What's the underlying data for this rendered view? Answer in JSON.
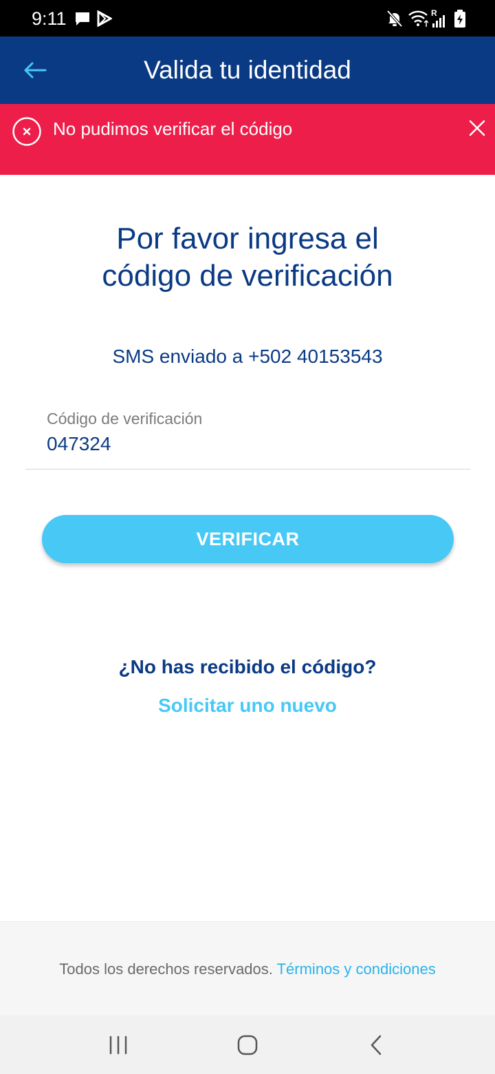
{
  "status_bar": {
    "time": "9:11",
    "left_icons": [
      "message-icon",
      "play-store-icon"
    ],
    "right_icons": [
      "mute-icon",
      "wifi-icon",
      "signal-icon",
      "battery-icon"
    ],
    "roaming_indicator": "R"
  },
  "app_bar": {
    "title": "Valida tu identidad",
    "back_icon": "arrow-left-icon"
  },
  "error_banner": {
    "message": "No pudimos verificar el código",
    "icon": "error-circle-x-icon",
    "close_icon": "close-icon"
  },
  "main": {
    "heading_line1": "Por favor ingresa el",
    "heading_line2": "código de verificación",
    "sms_info": "SMS enviado a +502 40153543",
    "code_field": {
      "label": "Código de verificación",
      "value": "047324"
    },
    "verify_button": "VERIFICAR",
    "resend_question": "¿No has recibido el código?",
    "resend_link": "Solicitar uno nuevo"
  },
  "footer": {
    "text": "Todos los derechos reservados. ",
    "terms_link": "Términos y condiciones"
  },
  "nav_bar": {
    "icons": [
      "recent-apps-icon",
      "home-icon",
      "back-icon"
    ]
  },
  "colors": {
    "primary_navy": "#0a3a84",
    "accent_sky": "#47c8f5",
    "error_red": "#ee1e4a",
    "link_blue": "#29b3ea"
  }
}
